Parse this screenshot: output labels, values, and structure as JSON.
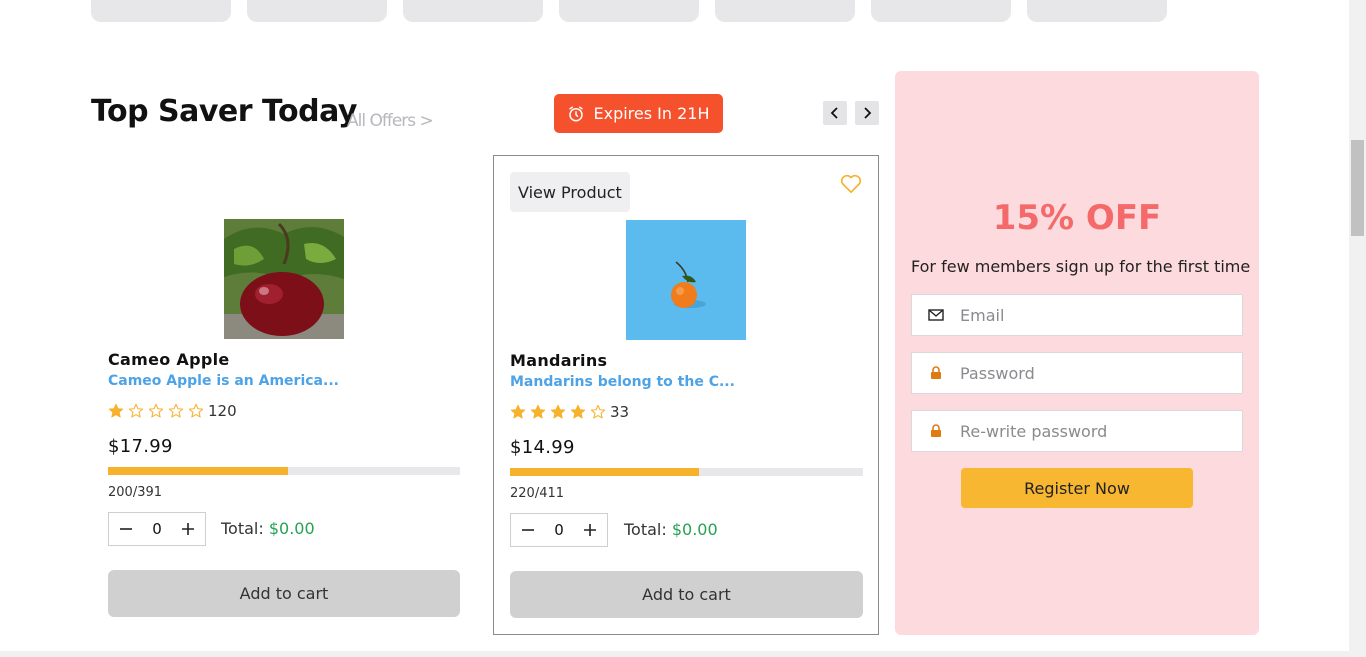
{
  "header": {
    "title": "Top Saver Today",
    "all_offers": "All Offers >",
    "expires": "Expires In 21H"
  },
  "products": [
    {
      "name": "Cameo Apple",
      "description": "Cameo Apple is an America...",
      "rating": 1,
      "review_count": "120",
      "price": "$17.99",
      "sold_fraction": 0.51,
      "stock": "200/391",
      "quantity": "0",
      "total_label": "Total:",
      "total_value": "$0.00",
      "add_to_cart": "Add to cart"
    },
    {
      "name": "Mandarins",
      "description": "Mandarins belong to the C...",
      "rating": 4,
      "review_count": "33",
      "price": "$14.99",
      "sold_fraction": 0.534,
      "stock": "220/411",
      "quantity": "0",
      "total_label": "Total:",
      "total_value": "$0.00",
      "add_to_cart": "Add to cart",
      "view_product": "View Product"
    }
  ],
  "signup": {
    "title": "15% OFF",
    "subtitle": "For few members sign up for the first time",
    "email_placeholder": "Email",
    "password_placeholder": "Password",
    "rewrite_placeholder": "Re-write password",
    "register_label": "Register Now"
  },
  "colors": {
    "accent_orange": "#f4512c",
    "star": "#f7b22d",
    "link_blue": "#4ea3e6",
    "price_green": "#27a155",
    "signup_bg": "#fddadd",
    "signup_title": "#f46a6a",
    "register_bg": "#f8b731"
  },
  "icons": [
    "alarm-clock-icon",
    "chevron-left-icon",
    "chevron-right-icon",
    "heart-icon",
    "star-icon",
    "minus-icon",
    "plus-icon",
    "envelope-icon",
    "lock-icon"
  ]
}
